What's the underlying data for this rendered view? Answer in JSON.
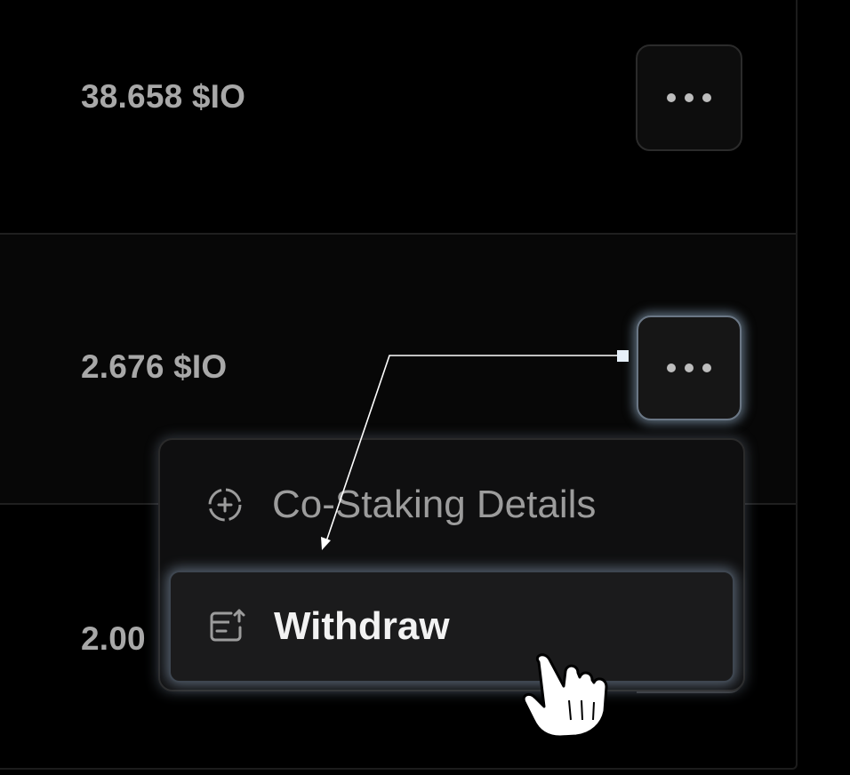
{
  "stakes": [
    {
      "amount": "38.658 $IO"
    },
    {
      "amount": "2.676 $IO"
    },
    {
      "amount": "2.00"
    }
  ],
  "more_button_icon": "ellipsis-icon",
  "menu": {
    "items": [
      {
        "label": "Co-Staking Details",
        "icon": "plus-circle-dashed-icon"
      },
      {
        "label": "Withdraw",
        "icon": "withdraw-card-icon"
      }
    ]
  },
  "colors": {
    "background": "#000000",
    "text_muted": "#a8a8a8",
    "highlight_glow": "#aac8e6"
  }
}
